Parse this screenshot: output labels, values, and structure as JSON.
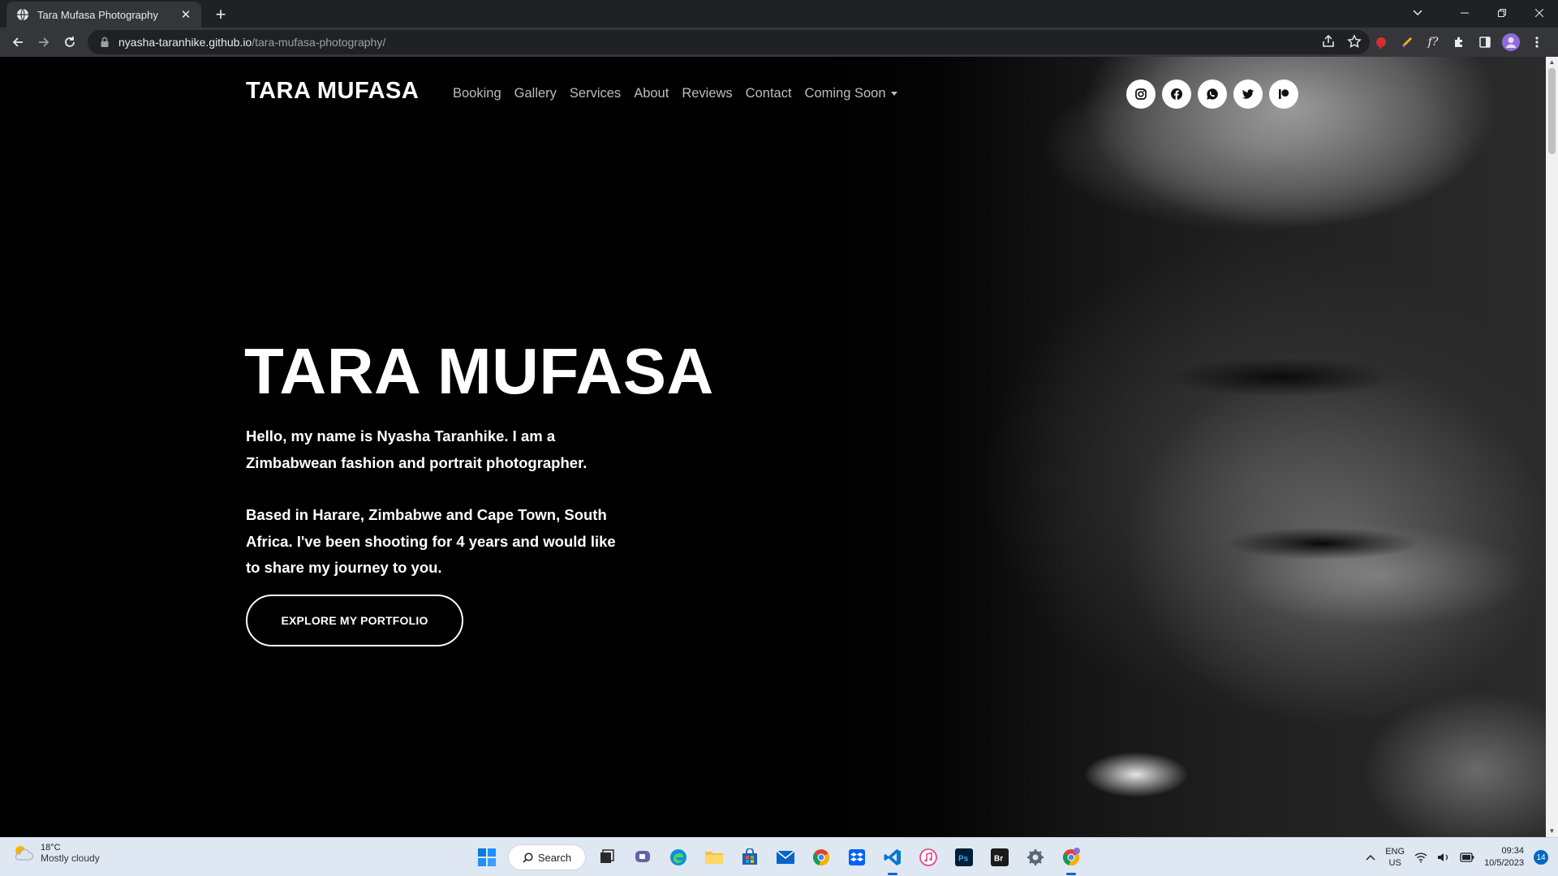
{
  "browser": {
    "tab_title": "Tara Mufasa Photography",
    "new_tab_symbol": "+",
    "url_host": "nyasha-taranhike.github.io",
    "url_path": "/tara-mufasa-photography/"
  },
  "site": {
    "brand": "TARA MUFASA",
    "nav": [
      "Booking",
      "Gallery",
      "Services",
      "About",
      "Reviews",
      "Contact",
      "Coming Soon"
    ],
    "socials": [
      "instagram-icon",
      "facebook-icon",
      "whatsapp-icon",
      "twitter-icon",
      "patreon-icon"
    ]
  },
  "hero": {
    "title": "TARA MUFASA",
    "paragraph1": "Hello, my name is Nyasha Taranhike. I am a Zimbabwean fashion and portrait photographer.",
    "paragraph2": "Based in Harare, Zimbabwe and Cape Town, South Africa. I've been shooting for 4 years and would like to share my journey to you.",
    "cta": "EXPLORE MY PORTFOLIO"
  },
  "taskbar": {
    "weather_temp": "18°C",
    "weather_desc": "Mostly cloudy",
    "search_label": "Search",
    "lang_line1": "ENG",
    "lang_line2": "US",
    "time": "09:34",
    "date": "10/5/2023",
    "notification_count": "14"
  }
}
